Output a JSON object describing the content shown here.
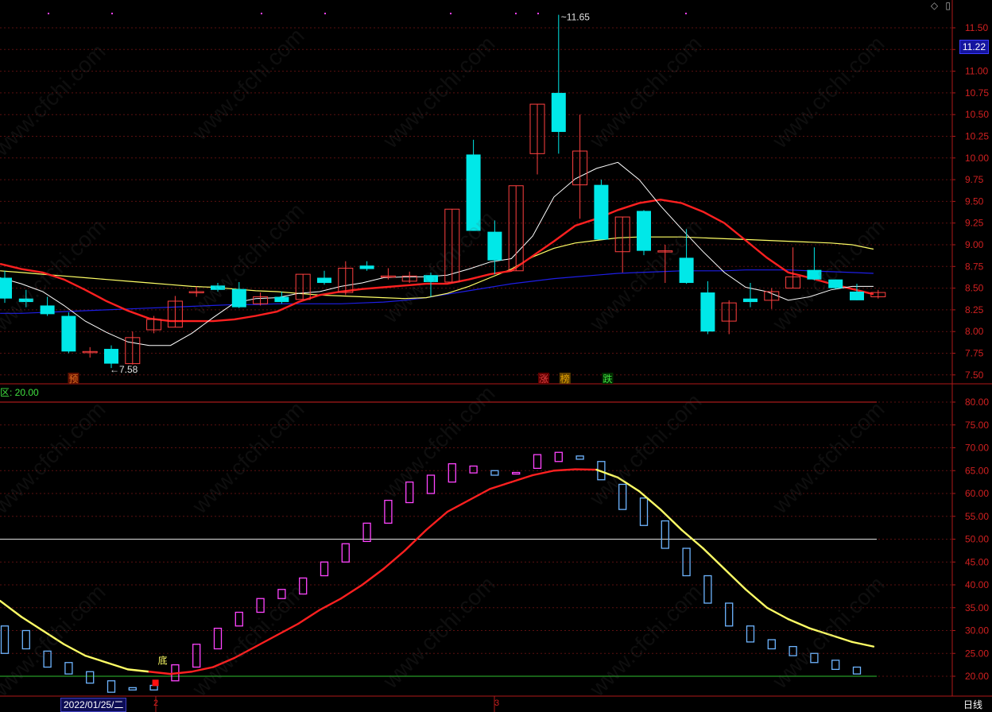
{
  "price_panel": {
    "y_ticks": [
      "11.50",
      "11.25",
      "11.00",
      "10.75",
      "10.50",
      "10.25",
      "10.00",
      "9.75",
      "9.50",
      "9.25",
      "9.00",
      "8.75",
      "8.50",
      "8.25",
      "8.00",
      "7.75",
      "7.50"
    ],
    "current_price": "11.22",
    "high_label": "11.65",
    "low_label": "7.58",
    "markers": [
      "预",
      "涨",
      "榜",
      "跌"
    ]
  },
  "indicator_panel": {
    "caption": "区: 20.00",
    "y_ticks": [
      "80.00",
      "75.00",
      "70.00",
      "65.00",
      "60.00",
      "55.00",
      "50.00",
      "45.00",
      "40.00",
      "35.00",
      "30.00",
      "25.00",
      "20.00"
    ],
    "bottom_label": "底"
  },
  "footer": {
    "date": "2022/01/25/二",
    "month_ticks": [
      "2",
      "3"
    ],
    "period": "日线"
  },
  "watermark": "www.cfchi.com",
  "colors": {
    "up": "#ff4040",
    "down": "#00e8e8",
    "ma5": "#ffffff",
    "ma10": "#ff2020",
    "ma20": "#ffff66",
    "ma60": "#1e1ee6",
    "osc_up": "#ff44ff",
    "osc_down": "#6eb4ff"
  },
  "chart_data": [
    {
      "type": "candlestick",
      "title": "",
      "ylim": [
        7.4,
        11.7
      ],
      "candles": [
        {
          "o": 8.62,
          "h": 8.7,
          "c": 8.38,
          "l": 8.33
        },
        {
          "o": 8.38,
          "h": 8.48,
          "c": 8.34,
          "l": 8.28
        },
        {
          "o": 8.3,
          "h": 8.4,
          "c": 8.2,
          "l": 8.18
        },
        {
          "o": 8.18,
          "h": 8.22,
          "c": 7.77,
          "l": 7.75
        },
        {
          "o": 7.77,
          "h": 7.82,
          "c": 7.77,
          "l": 7.7
        },
        {
          "o": 7.8,
          "h": 7.84,
          "c": 7.63,
          "l": 7.58
        },
        {
          "o": 7.63,
          "h": 8.0,
          "c": 7.93,
          "l": 7.62
        },
        {
          "o": 8.02,
          "h": 8.18,
          "c": 8.14,
          "l": 7.98
        },
        {
          "o": 8.05,
          "h": 8.41,
          "c": 8.35,
          "l": 8.05
        },
        {
          "o": 8.46,
          "h": 8.52,
          "c": 8.46,
          "l": 8.4
        },
        {
          "o": 8.53,
          "h": 8.56,
          "c": 8.48,
          "l": 8.46
        },
        {
          "o": 8.49,
          "h": 8.57,
          "c": 8.28,
          "l": 8.27
        },
        {
          "o": 8.32,
          "h": 8.45,
          "c": 8.4,
          "l": 8.3
        },
        {
          "o": 8.4,
          "h": 8.46,
          "c": 8.34,
          "l": 8.32
        },
        {
          "o": 8.37,
          "h": 8.66,
          "c": 8.66,
          "l": 8.36
        },
        {
          "o": 8.62,
          "h": 8.7,
          "c": 8.56,
          "l": 8.54
        },
        {
          "o": 8.45,
          "h": 8.81,
          "c": 8.73,
          "l": 8.42
        },
        {
          "o": 8.76,
          "h": 8.81,
          "c": 8.72,
          "l": 8.7
        },
        {
          "o": 8.64,
          "h": 8.73,
          "c": 8.64,
          "l": 8.6
        },
        {
          "o": 8.58,
          "h": 8.69,
          "c": 8.64,
          "l": 8.56
        },
        {
          "o": 8.65,
          "h": 8.68,
          "c": 8.57,
          "l": 8.4
        },
        {
          "o": 8.57,
          "h": 9.41,
          "c": 9.41,
          "l": 8.56
        },
        {
          "o": 10.04,
          "h": 10.21,
          "c": 9.16,
          "l": 9.16
        },
        {
          "o": 9.15,
          "h": 9.28,
          "c": 8.82,
          "l": 8.66
        },
        {
          "o": 8.7,
          "h": 9.68,
          "c": 9.68,
          "l": 8.7
        },
        {
          "o": 10.05,
          "h": 10.62,
          "c": 10.62,
          "l": 9.81
        },
        {
          "o": 10.75,
          "h": 11.65,
          "c": 10.3,
          "l": 10.05
        },
        {
          "o": 9.69,
          "h": 10.5,
          "c": 10.08,
          "l": 9.3
        },
        {
          "o": 9.69,
          "h": 9.75,
          "c": 9.06,
          "l": 9.06
        },
        {
          "o": 8.92,
          "h": 9.32,
          "c": 9.32,
          "l": 8.68
        },
        {
          "o": 9.39,
          "h": 9.4,
          "c": 8.93,
          "l": 8.88
        },
        {
          "o": 8.93,
          "h": 9.0,
          "c": 8.93,
          "l": 8.56
        },
        {
          "o": 8.85,
          "h": 9.18,
          "c": 8.56,
          "l": 8.55
        },
        {
          "o": 8.45,
          "h": 8.58,
          "c": 8.0,
          "l": 7.97
        },
        {
          "o": 8.12,
          "h": 8.36,
          "c": 8.33,
          "l": 7.97
        },
        {
          "o": 8.38,
          "h": 8.56,
          "c": 8.34,
          "l": 8.28
        },
        {
          "o": 8.36,
          "h": 8.5,
          "c": 8.46,
          "l": 8.26
        },
        {
          "o": 8.5,
          "h": 8.97,
          "c": 8.63,
          "l": 8.5
        },
        {
          "o": 8.71,
          "h": 8.97,
          "c": 8.6,
          "l": 8.59
        },
        {
          "o": 8.6,
          "h": 8.6,
          "c": 8.5,
          "l": 8.49
        },
        {
          "o": 8.46,
          "h": 8.55,
          "c": 8.36,
          "l": 8.36
        },
        {
          "o": 8.4,
          "h": 8.48,
          "c": 8.45,
          "l": 8.38
        }
      ],
      "ma5": [
        8.62,
        8.55,
        8.46,
        8.3,
        8.12,
        7.99,
        7.88,
        7.84,
        7.84,
        7.98,
        8.16,
        8.33,
        8.38,
        8.39,
        8.44,
        8.46,
        8.52,
        8.56,
        8.62,
        8.63,
        8.63,
        8.65,
        8.72,
        8.8,
        8.84,
        9.1,
        9.55,
        9.76,
        9.88,
        9.95,
        9.75,
        9.45,
        9.18,
        8.92,
        8.68,
        8.51,
        8.46,
        8.36,
        8.4,
        8.48,
        8.52,
        8.52
      ],
      "ma10": [
        8.78,
        8.72,
        8.68,
        8.6,
        8.48,
        8.35,
        8.24,
        8.15,
        8.12,
        8.12,
        8.12,
        8.14,
        8.18,
        8.23,
        8.34,
        8.42,
        8.46,
        8.49,
        8.51,
        8.53,
        8.55,
        8.55,
        8.6,
        8.66,
        8.7,
        8.87,
        9.04,
        9.22,
        9.3,
        9.4,
        9.48,
        9.52,
        9.48,
        9.38,
        9.25,
        9.05,
        8.85,
        8.68,
        8.62,
        8.55,
        8.49,
        8.43
      ],
      "ma20": [
        8.7,
        8.68,
        8.66,
        8.64,
        8.62,
        8.6,
        8.58,
        8.56,
        8.54,
        8.52,
        8.51,
        8.49,
        8.47,
        8.46,
        8.44,
        8.42,
        8.41,
        8.4,
        8.39,
        8.38,
        8.39,
        8.44,
        8.52,
        8.62,
        8.72,
        8.86,
        8.96,
        9.02,
        9.05,
        9.08,
        9.09,
        9.09,
        9.09,
        9.08,
        9.07,
        9.06,
        9.05,
        9.04,
        9.03,
        9.02,
        9.0,
        8.95
      ],
      "ma60": [
        8.21,
        8.21,
        8.22,
        8.23,
        8.24,
        8.25,
        8.26,
        8.27,
        8.28,
        8.29,
        8.3,
        8.31,
        8.31,
        8.32,
        8.32,
        8.32,
        8.32,
        8.33,
        8.34,
        8.36,
        8.39,
        8.43,
        8.47,
        8.51,
        8.55,
        8.58,
        8.61,
        8.63,
        8.65,
        8.67,
        8.68,
        8.69,
        8.7,
        8.7,
        8.7,
        8.71,
        8.71,
        8.71,
        8.7,
        8.69,
        8.68,
        8.67
      ]
    },
    {
      "type": "bar",
      "title": "",
      "ylim": [
        17,
        83
      ],
      "reference_lines": [
        80,
        50,
        20
      ],
      "osc": [
        {
          "o": 25,
          "c": 31,
          "up": false
        },
        {
          "o": 26,
          "c": 30,
          "up": false
        },
        {
          "o": 22,
          "c": 25.5,
          "up": false
        },
        {
          "o": 20.5,
          "c": 23,
          "up": false
        },
        {
          "o": 18.5,
          "c": 21,
          "up": false
        },
        {
          "o": 16.5,
          "c": 19,
          "up": false
        },
        {
          "o": 17,
          "c": 17.5,
          "up": false
        },
        {
          "o": 17,
          "c": 18,
          "up": false
        },
        {
          "o": 19,
          "c": 22.5,
          "up": true
        },
        {
          "o": 22,
          "c": 27,
          "up": true
        },
        {
          "o": 26,
          "c": 30.5,
          "up": true
        },
        {
          "o": 31,
          "c": 34,
          "up": true
        },
        {
          "o": 34,
          "c": 37,
          "up": true
        },
        {
          "o": 37,
          "c": 39,
          "up": true
        },
        {
          "o": 38,
          "c": 41.5,
          "up": true
        },
        {
          "o": 42,
          "c": 45,
          "up": true
        },
        {
          "o": 45,
          "c": 49,
          "up": true
        },
        {
          "o": 49.5,
          "c": 53.5,
          "up": true
        },
        {
          "o": 53.5,
          "c": 58.5,
          "up": true
        },
        {
          "o": 58,
          "c": 62.5,
          "up": true
        },
        {
          "o": 60,
          "c": 64,
          "up": true
        },
        {
          "o": 62.5,
          "c": 66.5,
          "up": true
        },
        {
          "o": 64.5,
          "c": 66,
          "up": true
        },
        {
          "o": 64,
          "c": 65,
          "up": false
        },
        {
          "o": 64.3,
          "c": 64.6,
          "up": true
        },
        {
          "o": 65.5,
          "c": 68.5,
          "up": true
        },
        {
          "o": 67,
          "c": 69,
          "up": true
        },
        {
          "o": 67.5,
          "c": 68.2,
          "up": false
        },
        {
          "o": 63,
          "c": 67,
          "up": false
        },
        {
          "o": 56.5,
          "c": 62,
          "up": false
        },
        {
          "o": 53,
          "c": 59,
          "up": false
        },
        {
          "o": 48,
          "c": 54,
          "up": false
        },
        {
          "o": 42,
          "c": 48,
          "up": false
        },
        {
          "o": 36,
          "c": 42,
          "up": false
        },
        {
          "o": 31,
          "c": 36,
          "up": false
        },
        {
          "o": 27.5,
          "c": 31,
          "up": false
        },
        {
          "o": 26,
          "c": 28,
          "up": false
        },
        {
          "o": 24.5,
          "c": 26.5,
          "up": false
        },
        {
          "o": 23,
          "c": 25,
          "up": false
        },
        {
          "o": 21.5,
          "c": 23.5,
          "up": false
        },
        {
          "o": 20.5,
          "c": 22,
          "up": false
        }
      ],
      "signal": [
        36.5,
        33,
        30,
        27,
        24.5,
        23,
        21.5,
        21,
        20.5,
        21,
        22,
        24,
        26.5,
        29,
        31.5,
        34.5,
        37,
        40,
        43.5,
        47.5,
        52,
        56,
        58.5,
        61,
        62.5,
        64,
        65,
        65.3,
        65.2,
        63.5,
        60.5,
        56.5,
        52,
        48,
        43.5,
        39,
        35,
        32.5,
        30.5,
        29,
        27.5,
        26.5
      ],
      "signal_yellow_indices": [
        0,
        1,
        2,
        3,
        4,
        5,
        6,
        7,
        28,
        29,
        30,
        31,
        32,
        33,
        34,
        35,
        36,
        37,
        38,
        39,
        40,
        41
      ]
    }
  ]
}
